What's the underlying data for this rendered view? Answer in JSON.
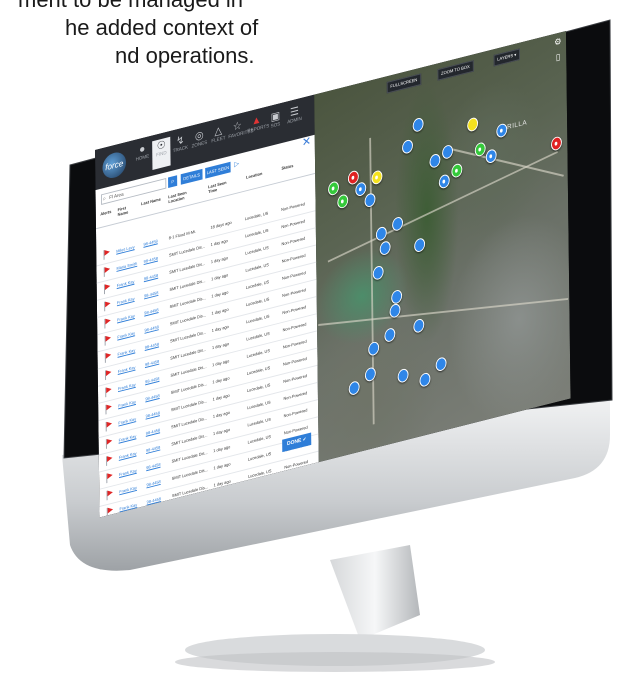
{
  "intro_text": {
    "line1": "ment to be managed in",
    "line2": "he added context of",
    "line3": "nd operations."
  },
  "app": {
    "logo": "force",
    "nav": [
      {
        "label": "HOME",
        "icon": "home-icon"
      },
      {
        "label": "FIND",
        "icon": "target-icon",
        "selected": true
      },
      {
        "label": "TRACK",
        "icon": "route-icon"
      },
      {
        "label": "ZONES",
        "icon": "location-icon"
      },
      {
        "label": "FLEET",
        "icon": "fleet-icon"
      },
      {
        "label": "FAVORITES",
        "icon": "star-icon"
      },
      {
        "label": "REPORTS",
        "icon": "alert-icon",
        "alert": true
      },
      {
        "label": "SOS",
        "icon": "sos-icon"
      },
      {
        "label": "ADMIN",
        "icon": "menu-icon"
      }
    ]
  },
  "panel": {
    "search_value": "Fl Area",
    "buttons": {
      "one": "DETAILS",
      "two": "LAST SEEN"
    },
    "headers": [
      "Alerts",
      "First Name",
      "Last Name",
      "Last Seen Location",
      "Last Seen Time",
      "Location",
      "Status"
    ],
    "rows": [
      {
        "first": "Miles Levy",
        "last": "98-4458",
        "company": "8-1 Flood M-Mi.",
        "time": "18 days ago",
        "location": "Lucedale, US",
        "status": "Non-Powered"
      },
      {
        "first": "Maria Smith",
        "last": "98-4458",
        "company": "SMIT Lucedale Dis...",
        "time": "1 day ago",
        "location": "Lucedale, US",
        "status": "Non-Powered"
      },
      {
        "first": "Frank Kay",
        "last": "98-4458",
        "company": "SMIT Lucedale Dis...",
        "time": "1 day ago",
        "location": "Lucedale, US",
        "status": "Non-Powered"
      },
      {
        "first": "Frank Kay",
        "last": "98-4458",
        "company": "SMIT Lucedale Dis...",
        "time": "1 day ago",
        "location": "Lucedale, US",
        "status": "Non-Powered"
      },
      {
        "first": "Frank Kay",
        "last": "98-4458",
        "company": "SMIT Lucedale Dis...",
        "time": "1 day ago",
        "location": "Lucedale, US",
        "status": "Non-Powered"
      },
      {
        "first": "Frank Kay",
        "last": "98-4458",
        "company": "SMIT Lucedale Dis...",
        "time": "1 day ago",
        "location": "Lucedale, US",
        "status": "Non-Powered"
      },
      {
        "first": "Frank Kay",
        "last": "98-4458",
        "company": "SMIT Lucedale Dis...",
        "time": "1 day ago",
        "location": "Lucedale, US",
        "status": "Non-Powered"
      },
      {
        "first": "Frank Kay",
        "last": "98-4458",
        "company": "SMIT Lucedale Dis...",
        "time": "1 day ago",
        "location": "Lucedale, US",
        "status": "Non-Powered"
      },
      {
        "first": "Frank Kay",
        "last": "98-4458",
        "company": "SMIT Lucedale Dis...",
        "time": "1 day ago",
        "location": "Lucedale, US",
        "status": "Non-Powered"
      },
      {
        "first": "Frank Kay",
        "last": "98-4458",
        "company": "SMIT Lucedale Dis...",
        "time": "1 day ago",
        "location": "Lucedale, US",
        "status": "Non-Powered"
      },
      {
        "first": "Frank Kay",
        "last": "98-4458",
        "company": "SMIT Lucedale Dis...",
        "time": "1 day ago",
        "location": "Lucedale, US",
        "status": "Non-Powered"
      },
      {
        "first": "Frank Kay",
        "last": "98-4458",
        "company": "SMIT Lucedale Dis...",
        "time": "1 day ago",
        "location": "Lucedale, US",
        "status": "Non-Powered"
      },
      {
        "first": "Frank Kay",
        "last": "98-4458",
        "company": "SMIT Lucedale Dis...",
        "time": "1 day ago",
        "location": "Lucedale, US",
        "status": "Non-Powered"
      },
      {
        "first": "Frank Kay",
        "last": "98-4458",
        "company": "SMIT Lucedale Dis...",
        "time": "1 day ago",
        "location": "Lucedale, US",
        "status": "Non-Powered"
      },
      {
        "first": "Frank Kay",
        "last": "98-4458",
        "company": "SMIT Lucedale Dis...",
        "time": "1 day ago",
        "location": "Lucedale, US",
        "status": "Non-Powered"
      },
      {
        "first": "Frank Kay",
        "last": "98-4458",
        "company": "SMIT Lucedale Dis...",
        "time": "1 day ago",
        "location": "Lucedale, US",
        "status": "Non-Powered"
      }
    ],
    "done_label": "DONE"
  },
  "map": {
    "buttons": [
      "FULLSCREEN",
      "ZOOM TO BOX",
      "LAYERS"
    ],
    "place_label": "ORILLA",
    "colors": {
      "blue": "#2f86e8",
      "green": "#35c93b",
      "red": "#e02222",
      "yellow": "#f4e21e"
    }
  }
}
